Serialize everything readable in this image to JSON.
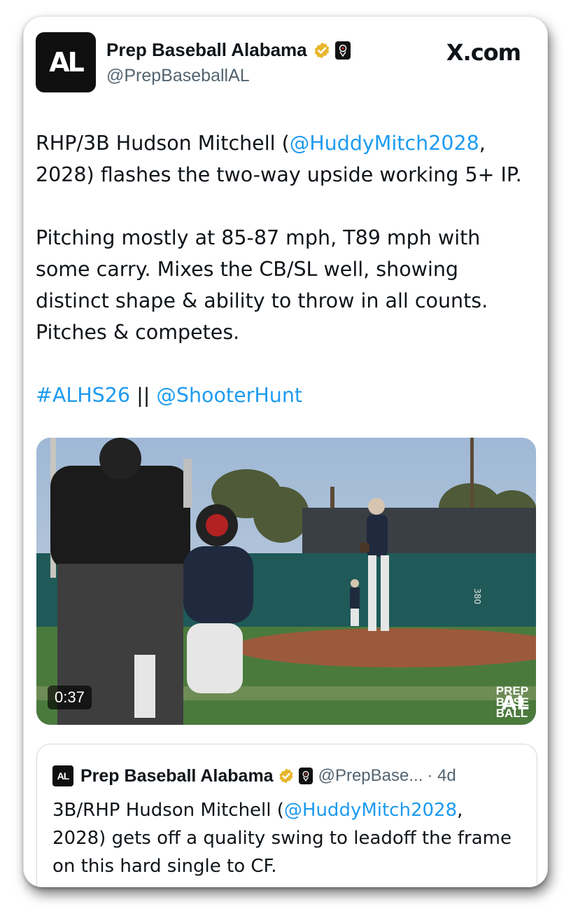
{
  "source_label": "X.com",
  "author": {
    "display_name": "Prep Baseball Alabama",
    "handle": "@PrepBaseballAL",
    "avatar_text": "AL"
  },
  "tweet": {
    "p1_a": "RHP/3B Hudson Mitchell (",
    "p1_link": "@HuddyMitch2028",
    "p1_b": ", 2028) flashes the two-way upside working 5+ IP.",
    "p2": "Pitching mostly at 85-87 mph, T89 mph with some carry. Mixes the CB/SL well, showing distinct shape & ability to throw in all counts. Pitches & competes.",
    "hashtag": "#ALHS26",
    "separator": " || ",
    "mention": "@ShooterHunt"
  },
  "media": {
    "duration": "0:37",
    "watermark_lines": [
      "PREP",
      "BASE",
      "BALL"
    ],
    "watermark_badge": "AL",
    "wall_marking": "380"
  },
  "quoted": {
    "avatar_text": "AL",
    "display_name": "Prep Baseball Alabama",
    "handle": "@PrepBase...",
    "time": "· 4d",
    "text_a": "3B/RHP Hudson Mitchell (",
    "text_link": "@HuddyMitch2028",
    "text_b": ", 2028) gets off a quality swing to leadoff the frame on this hard single to CF."
  },
  "colors": {
    "link": "#1d9bf0",
    "verified": "#e8b62c",
    "text": "#0f1419",
    "muted": "#536471"
  },
  "icons": [
    "verified-badge-icon",
    "affiliate-badge-icon",
    "x-logo-icon"
  ]
}
